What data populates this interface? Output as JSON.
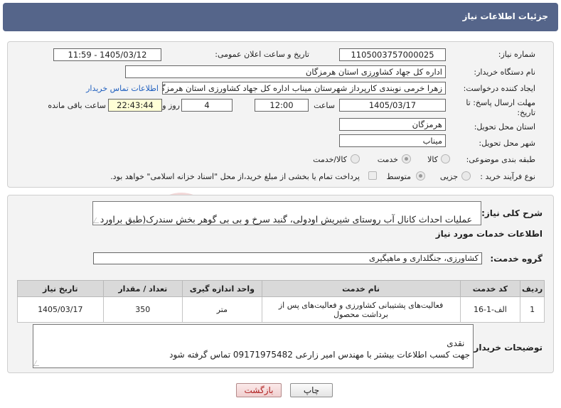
{
  "header": {
    "title": "جزئیات اطلاعات نیاز"
  },
  "form": {
    "need_number_label": "شماره نیاز:",
    "need_number": "1105003757000025",
    "announce_label": "تاریخ و ساعت اعلان عمومی:",
    "announce_value": "1405/03/12 - 11:59",
    "buyer_label": "نام دستگاه خریدار:",
    "buyer_value": "اداره کل جهاد کشاورزی استان هرمزگان",
    "creator_label": "ایجاد کننده درخواست:",
    "creator_value": "زهرا خرمی نوبندی کارپرداز شهرستان میناب اداره کل جهاد کشاورزی استان هرمزگان",
    "contact_link": "اطلاعات تماس خریدار",
    "deadline_label_line1": "مهلت ارسال پاسخ: تا",
    "deadline_label_line2": "تاریخ:",
    "deadline_date": "1405/03/17",
    "time_label": "ساعت",
    "deadline_time": "12:00",
    "days_value": "4",
    "days_label": "روز و",
    "remaining_value": "22:43:44",
    "remaining_label": "ساعت باقی مانده",
    "province_label": "استان محل تحویل:",
    "province_value": "هرمزگان",
    "city_label": "شهر محل تحویل:",
    "city_value": "میناب",
    "category_label": "طبقه بندی موضوعی:",
    "category_options": [
      "کالا",
      "خدمت",
      "کالا/خدمت"
    ],
    "category_selected": "خدمت",
    "process_label": "نوع فرآیند خرید :",
    "process_options": [
      "جزیی",
      "متوسط"
    ],
    "process_selected": "متوسط",
    "payment_note": "پرداخت تمام یا بخشی از مبلغ خرید،از محل \"اسناد خزانه اسلامی\" خواهد بود."
  },
  "details": {
    "summary_label": "شرح کلی نیاز:",
    "summary_value": "عملیات احداث کانال آب روستای شیریش اودولی، گنبد سرخ و بی بی گوهر بخش سندرک(طبق براورد پیوست)",
    "services_heading": "اطلاعات خدمات مورد نیاز",
    "service_group_label": "گروه خدمت:",
    "service_group_value": "کشاورزی، جنگلداری و ماهیگیری",
    "table": {
      "headers": [
        "ردیف",
        "کد خدمت",
        "نام خدمت",
        "واحد اندازه گیری",
        "تعداد / مقدار",
        "تاریخ نیاز"
      ],
      "rows": [
        [
          "1",
          "الف-1-16",
          "فعالیت‌های پشتیبانی کشاورزی و فعالیت‌های پس از برداشت محصول",
          "متر",
          "350",
          "1405/03/17"
        ]
      ]
    },
    "buyer_notes_label": "توضیحات خریدار:",
    "buyer_notes_value": "نقدی\nجهت کسب اطلاعات بیشتر با مهندس امیر زارعی 09171975482 تماس گرفته شود"
  },
  "buttons": {
    "print": "چاپ",
    "back": "بازگشت"
  },
  "colors": {
    "header_bg": "#55658a",
    "link": "#1f5fbf",
    "back_text": "#b02020"
  }
}
